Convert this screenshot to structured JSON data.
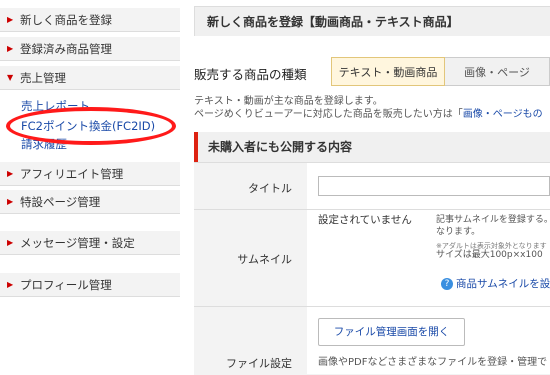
{
  "sidebar": {
    "items": [
      {
        "label": "新しく商品を登録"
      },
      {
        "label": "登録済み商品管理"
      },
      {
        "label": "売上管理"
      },
      {
        "label": "アフィリエイト管理"
      },
      {
        "label": "特設ページ管理"
      },
      {
        "label": "メッセージ管理・設定"
      },
      {
        "label": "プロフィール管理"
      }
    ],
    "sub_items": [
      {
        "label": "売上レポート"
      },
      {
        "label": "FC2ポイント換金(FC2ID)"
      },
      {
        "label": "請求履歴"
      }
    ]
  },
  "main": {
    "page_title": "新しく商品を登録【動画商品・テキスト商品】",
    "type_label": "販売する商品の種類",
    "tabs": [
      {
        "label": "テキスト・動画商品"
      },
      {
        "label": "画像・ページ"
      }
    ],
    "description_line1": "テキスト・動画が主な商品を登録します。",
    "description_line2_pre": "ページめくりビューアーに対応した商品を販売したい方は「",
    "description_line2_link": "画像・ページもの",
    "section_title": "未購入者にも公開する内容",
    "fields": {
      "title_label": "タイトル",
      "thumbnail_label": "サムネイル",
      "thumbnail_status": "設定されていません",
      "thumbnail_note_1": "記事サムネイルを登録する。",
      "thumbnail_note_2": "なります。",
      "thumbnail_note_3": "※アダルトは表示対象外となります",
      "thumbnail_note_4": "サイズは最大100p×x100",
      "thumbnail_help": "商品サムネイルを設",
      "file_label": "ファイル設定",
      "file_button": "ファイル管理画面を開く",
      "file_note": "画像やPDFなどさまざまなファイルを登録・管理で"
    }
  }
}
